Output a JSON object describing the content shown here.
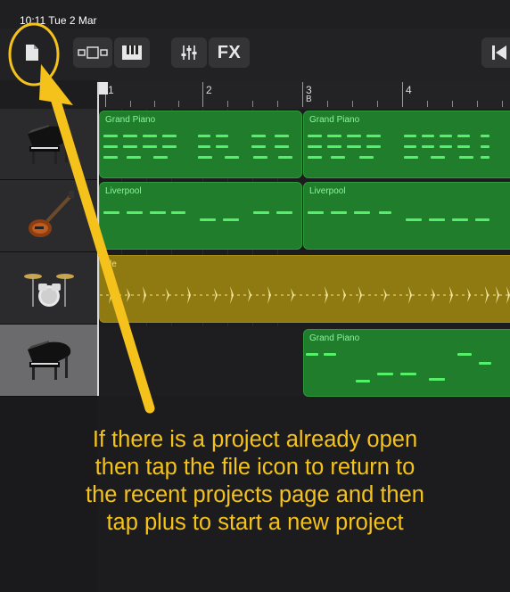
{
  "status_bar": {
    "time": "10:11  Tue 2 Mar"
  },
  "toolbar": {
    "file_icon": "file-icon",
    "view_icon": "tracks-view-icon",
    "keyboard_icon": "keyboard-icon",
    "mixer_icon": "mixer-icon",
    "fx_label": "FX",
    "goto_start_icon": "go-to-start-icon"
  },
  "ruler": {
    "bars": [
      "1",
      "2",
      "3",
      "4"
    ],
    "section_marker": "B"
  },
  "tracks": [
    {
      "instrument": "Grand Piano",
      "icon": "grand-piano-icon",
      "selected": false
    },
    {
      "instrument": "Liverpool",
      "icon": "bass-guitar-icon",
      "selected": false
    },
    {
      "instrument": "Drums",
      "icon": "drum-kit-icon",
      "selected": false
    },
    {
      "instrument": "Grand Piano",
      "icon": "grand-piano-icon",
      "selected": true
    }
  ],
  "regions": {
    "track1": [
      "Grand Piano",
      "Grand Piano"
    ],
    "track2": [
      "Liverpool",
      "Liverpool"
    ],
    "track3": [
      "yle"
    ],
    "track4": [
      "Grand Piano"
    ]
  },
  "annotation": {
    "lines": [
      "If there is a project already open",
      "then tap the file icon to return to",
      "the recent projects page and then",
      "tap plus to start a new project"
    ],
    "color": "#f4c21b"
  },
  "colors": {
    "region_green": "#1f7d2c",
    "region_yellow": "#8f7a12",
    "note_green": "#55f06a",
    "accent": "#f4c21b"
  }
}
